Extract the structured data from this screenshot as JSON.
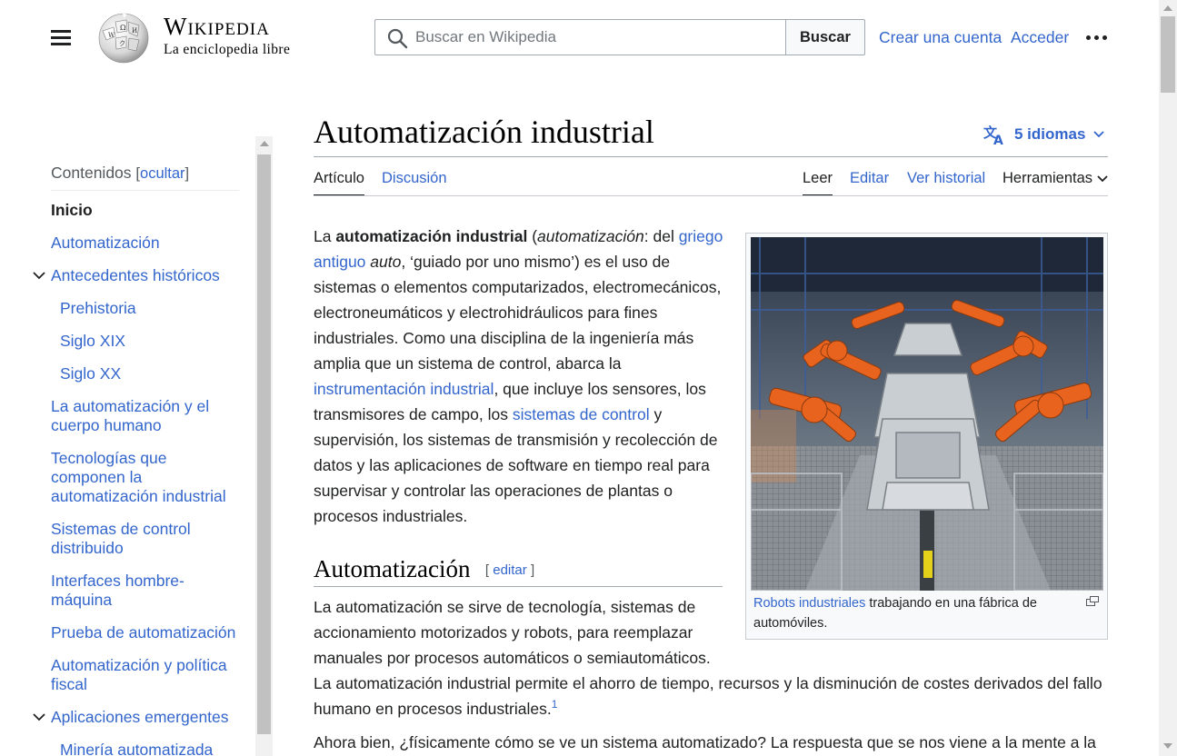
{
  "header": {
    "wordmark": "Wikipedia",
    "tagline": "La enciclopedia libre",
    "search_placeholder": "Buscar en Wikipedia",
    "search_button": "Buscar",
    "create_account": "Crear una cuenta",
    "login": "Acceder"
  },
  "toc": {
    "heading": "Contenidos",
    "hide_label": "ocultar",
    "items": [
      {
        "label": "Inicio"
      },
      {
        "label": "Automatización"
      },
      {
        "label": "Antecedentes históricos"
      },
      {
        "label": "Prehistoria"
      },
      {
        "label": "Siglo XIX"
      },
      {
        "label": "Siglo XX"
      },
      {
        "label": "La automatización y el cuerpo humano"
      },
      {
        "label": "Tecnologías que componen la automatización industrial"
      },
      {
        "label": "Sistemas de control distribuido"
      },
      {
        "label": "Interfaces hombre-máquina"
      },
      {
        "label": "Prueba de automatización"
      },
      {
        "label": "Automatización y política fiscal"
      },
      {
        "label": "Aplicaciones emergentes"
      },
      {
        "label": "Minería automatizada"
      }
    ]
  },
  "page": {
    "title": "Automatización industrial",
    "languages": "5 idiomas",
    "tabs": {
      "article": "Artículo",
      "discussion": "Discusión",
      "read": "Leer",
      "edit": "Editar",
      "history": "Ver historial",
      "tools": "Herramientas"
    }
  },
  "content": {
    "intro": {
      "t1": "La ",
      "bold": "automatización industrial",
      "t2": " (",
      "italic1": "automatización",
      "t3": ": del ",
      "link1": "griego antiguo",
      "t4": " ",
      "italic2": "auto",
      "t5": ", ‘guiado por uno mismo’) es el uso de sistemas o elementos computarizados, electromecánicos, electroneumáticos y electrohidráulicos para fines industriales. Como una disciplina de la ingeniería más amplia que un sistema de control, abarca la ",
      "link2": "instrumentación industrial",
      "t6": ", que incluye los sensores, los transmisores de campo, los ",
      "link3": "sistemas de control",
      "t7": " y supervisión, los sistemas de transmisión y recolección de datos y las aplicaciones de software en tiempo real para supervisar y controlar las operaciones de plantas o procesos industriales."
    },
    "section1": {
      "heading": "Automatización",
      "edit_label": "editar",
      "p1": "La automatización se sirve de tecnología, sistemas de accionamiento motorizados y robots, para reemplazar manuales por procesos automáticos o semiautomáticos.",
      "p2": "La automatización industrial permite el ahorro de tiempo, recursos y la disminución de costes derivados del fallo humano en procesos industriales.",
      "ref": "1",
      "p3": "Ahora bien, ¿físicamente cómo se ve un sistema automatizado? La respuesta que se nos viene a la mente a la"
    },
    "figure": {
      "caption_link": "Robots industriales",
      "caption_text": " trabajando en una fábrica de automóviles."
    }
  },
  "colors": {
    "link": "#3366cc",
    "text": "#202122",
    "robot_orange": "#e8641e"
  }
}
